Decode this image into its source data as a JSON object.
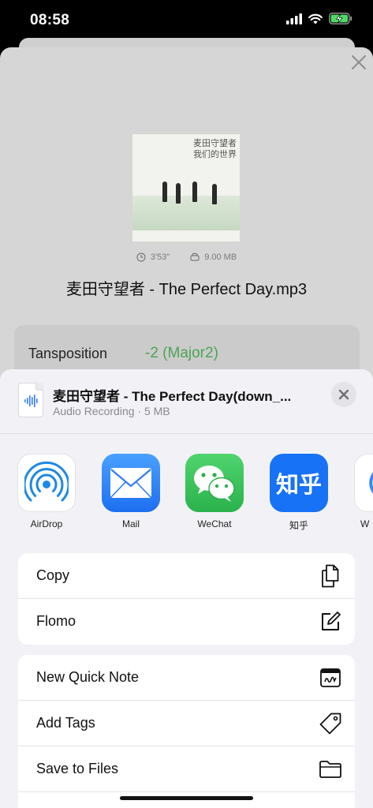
{
  "status": {
    "time": "08:58"
  },
  "player": {
    "album_text_line1": "麦田守望者",
    "album_text_line2": "我们的世界",
    "duration": "3'53\"",
    "size": "9.00 MB",
    "title": "麦田守望者 - The Perfect Day.mp3",
    "transposition_label": "Tansposition",
    "transposition_value": "-2 (Major2)"
  },
  "share": {
    "title": "麦田守望者 - The Perfect Day(down_...",
    "subtitle": "Audio Recording · 5 MB",
    "apps": [
      {
        "label": "AirDrop",
        "icon": "airdrop-icon"
      },
      {
        "label": "Mail",
        "icon": "mail-icon"
      },
      {
        "label": "WeChat",
        "icon": "wechat-icon"
      },
      {
        "label": "知乎",
        "icon": "zhihu-icon",
        "icon_text": "知乎"
      },
      {
        "label": "W",
        "icon": "partial-app-icon"
      }
    ],
    "group1": [
      {
        "label": "Copy",
        "icon": "copy-icon"
      },
      {
        "label": "Flomo",
        "icon": "compose-icon"
      }
    ],
    "group2": [
      {
        "label": "New Quick Note",
        "icon": "quick-note-icon"
      },
      {
        "label": "Add Tags",
        "icon": "tag-icon"
      },
      {
        "label": "Save to Files",
        "icon": "folder-icon"
      }
    ]
  },
  "colors": {
    "accent_green": "#4da454",
    "airdrop_blue": "#1e88e5",
    "mail_blue": "#2f7cf6",
    "wechat_green": "#35c35b",
    "zhihu_blue": "#1772f6"
  }
}
